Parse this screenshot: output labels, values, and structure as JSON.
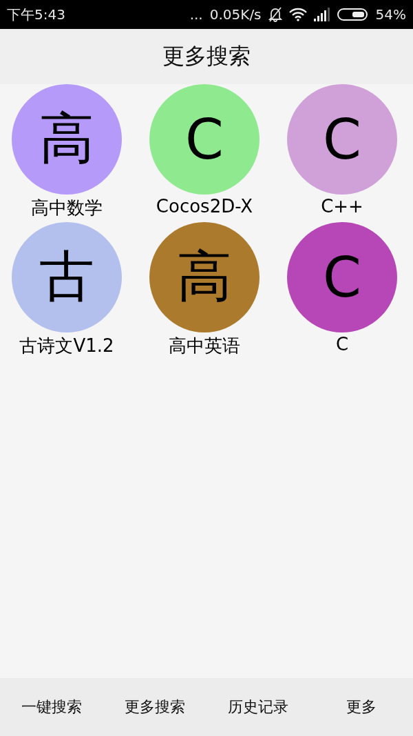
{
  "status_bar": {
    "time": "下午5:43",
    "overflow": "...",
    "speed": "0.05K/s",
    "battery": "54%"
  },
  "title": "更多搜索",
  "apps": [
    {
      "glyph": "高",
      "label": "高中数学",
      "color": "#b59afa"
    },
    {
      "glyph": "C",
      "label": "Cocos2D-X",
      "color": "#8fe98f"
    },
    {
      "glyph": "C",
      "label": "C++",
      "color": "#cfa1d8"
    },
    {
      "glyph": "古",
      "label": "古诗文V1.2",
      "color": "#b3c0ee"
    },
    {
      "glyph": "高",
      "label": "高中英语",
      "color": "#ab7a2d"
    },
    {
      "glyph": "C",
      "label": "C",
      "color": "#b746b7"
    }
  ],
  "nav": [
    {
      "label": "一键搜索"
    },
    {
      "label": "更多搜索"
    },
    {
      "label": "历史记录"
    },
    {
      "label": "更多"
    }
  ]
}
